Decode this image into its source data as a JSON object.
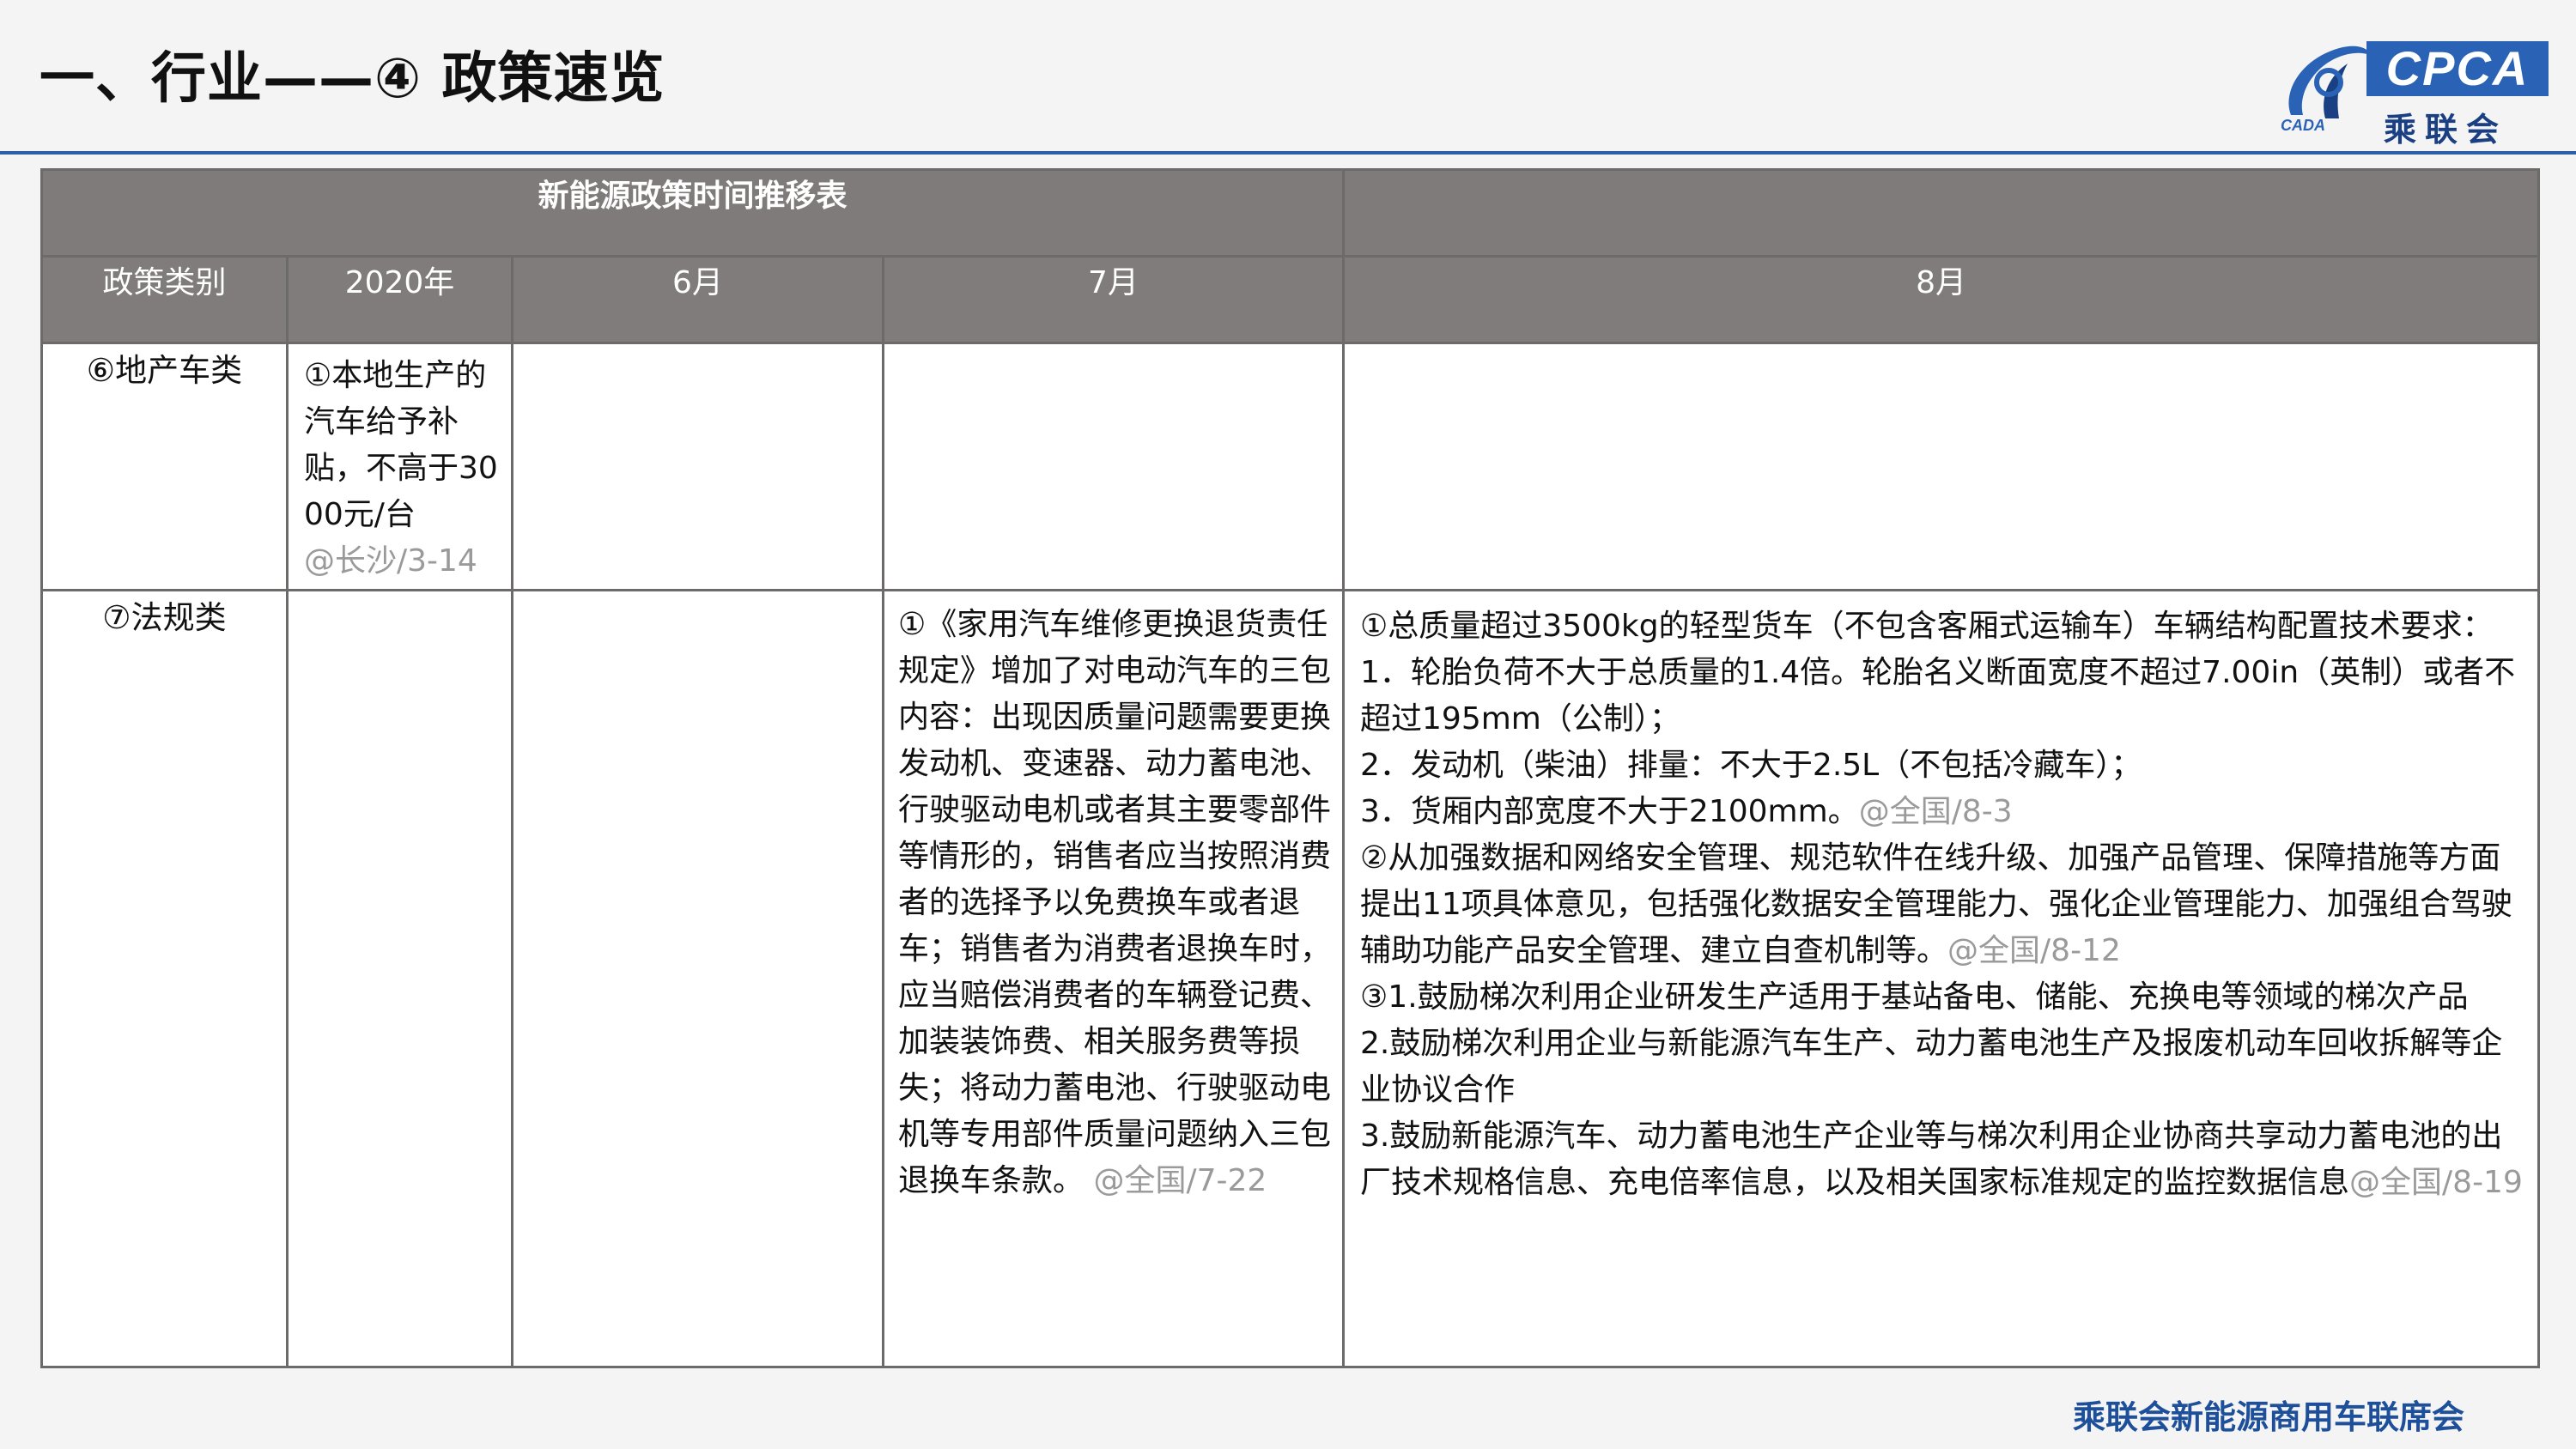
{
  "header": {
    "title": "一、行业——④ 政策速览",
    "logo": {
      "brand": "CPCA",
      "brand_cn": "乘联会",
      "emblem_text": "CADA",
      "brand_color": "#2a63b6"
    }
  },
  "table": {
    "title": "新能源政策时间推移表",
    "columns": [
      "政策类别",
      "2020年",
      "6月",
      "7月",
      "8月"
    ],
    "rows": [
      {
        "category": "⑥地产车类",
        "y2020": {
          "text": "①本地生产的汽车给予补贴，不高于3000元/台",
          "source": "@长沙/3-14"
        },
        "jun": "",
        "jul": "",
        "aug": ""
      },
      {
        "category": "⑦法规类",
        "y2020": "",
        "jun": "",
        "jul": {
          "text": "①《家用汽车维修更换退货责任规定》增加了对电动汽车的三包内容：出现因质量问题需要更换发动机、变速器、动力蓄电池、行驶驱动电机或者其主要零部件等情形的，销售者应当按照消费者的选择予以免费换车或者退车；销售者为消费者退换车时，应当赔偿消费者的车辆登记费、加装装饰费、相关服务费等损失；将动力蓄电池、行驶驱动电机等专用部件质量问题纳入三包退换车条款。",
          "source": "@全国/7-22"
        },
        "aug": {
          "items": [
            {
              "lines": [
                "①总质量超过3500kg的轻型货车（不包含客厢式运输车）车辆结构配置技术要求：",
                "1．轮胎负荷不大于总质量的1.4倍。轮胎名义断面宽度不超过7.00in（英制）或者不超过195mm（公制）；",
                "2．发动机（柴油）排量：不大于2.5L（不包括冷藏车）；",
                "3．货厢内部宽度不大于2100mm。"
              ],
              "source": "@全国/8-3"
            },
            {
              "lines": [
                "②从加强数据和网络安全管理、规范软件在线升级、加强产品管理、保障措施等方面提出11项具体意见，包括强化数据安全管理能力、强化企业管理能力、加强组合驾驶辅助功能产品安全管理、建立自查机制等。"
              ],
              "source": "@全国/8-12"
            },
            {
              "lines": [
                "③1.鼓励梯次利用企业研发生产适用于基站备电、储能、充换电等领域的梯次产品",
                "2.鼓励梯次利用企业与新能源汽车生产、动力蓄电池生产及报废机动车回收拆解等企业协议合作",
                "3.鼓励新能源汽车、动力蓄电池生产企业等与梯次利用企业协商共享动力蓄电池的出厂技术规格信息、充电倍率信息，以及相关国家标准规定的监控数据信息"
              ],
              "source": "@全国/8-19"
            }
          ]
        }
      }
    ]
  },
  "footer": "乘联会新能源商用车联席会",
  "colors": {
    "header_rule": "#2b5fa6",
    "table_header_bg": "#7f7b7b",
    "source_text": "#9a9a9a",
    "footer_text": "#1d4f9a"
  }
}
